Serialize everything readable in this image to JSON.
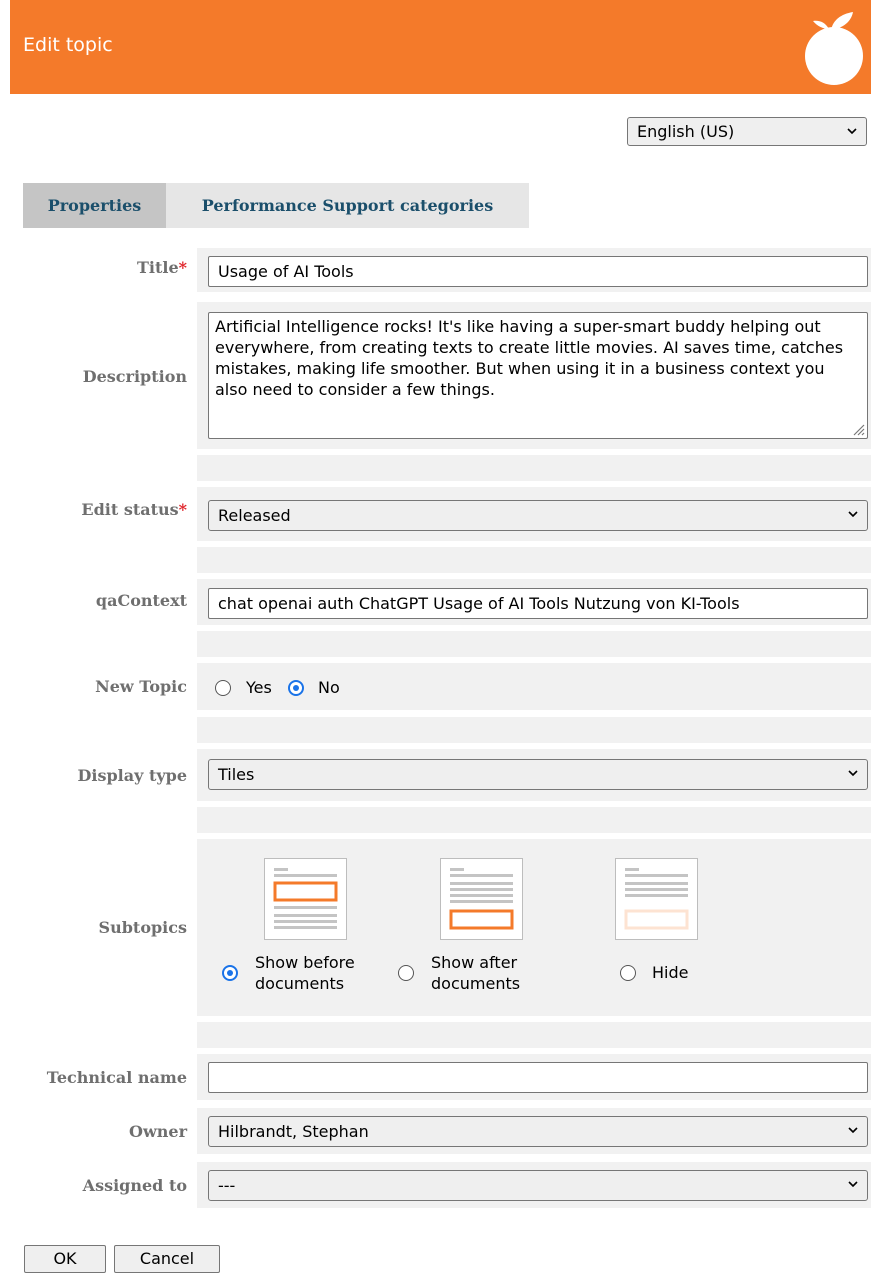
{
  "header": {
    "title": "Edit topic",
    "logo": "orange-logo"
  },
  "language": {
    "selected": "English (US)"
  },
  "tabs": [
    {
      "label": "Properties",
      "active": true
    },
    {
      "label": "Performance Support categories",
      "active": false
    }
  ],
  "form": {
    "title": {
      "label": "Title",
      "required": "*",
      "value": "Usage of AI Tools"
    },
    "description": {
      "label": "Description",
      "value": "Artificial Intelligence rocks! It's like having a super-smart buddy helping out everywhere, from creating texts to create little movies. AI saves time, catches mistakes, making life smoother. But when using it in a business context you also need to consider a few things."
    },
    "edit_status": {
      "label": "Edit status",
      "required": "*",
      "value": "Released"
    },
    "qa_context": {
      "label": "qaContext",
      "value": "chat openai auth ChatGPT Usage of AI Tools Nutzung von KI-Tools"
    },
    "new_topic": {
      "label": "New Topic",
      "options": [
        "Yes",
        "No"
      ],
      "selected": "No"
    },
    "display_type": {
      "label": "Display type",
      "value": "Tiles"
    },
    "subtopics": {
      "label": "Subtopics",
      "options": [
        {
          "line1": "Show before",
          "line2": "documents",
          "selected": true
        },
        {
          "line1": "Show after",
          "line2": "documents",
          "selected": false
        },
        {
          "line1": "Hide",
          "line2": "",
          "selected": false
        }
      ]
    },
    "technical_name": {
      "label": "Technical name",
      "value": ""
    },
    "owner": {
      "label": "Owner",
      "value": "Hilbrandt, Stephan"
    },
    "assigned_to": {
      "label": "Assigned to",
      "value": "---"
    }
  },
  "buttons": {
    "ok": "OK",
    "cancel": "Cancel"
  },
  "colors": {
    "header": "#f47a2a",
    "tab_text": "#1b4f6b",
    "radio_selected": "#1a73e8",
    "required": "#e0242a"
  }
}
